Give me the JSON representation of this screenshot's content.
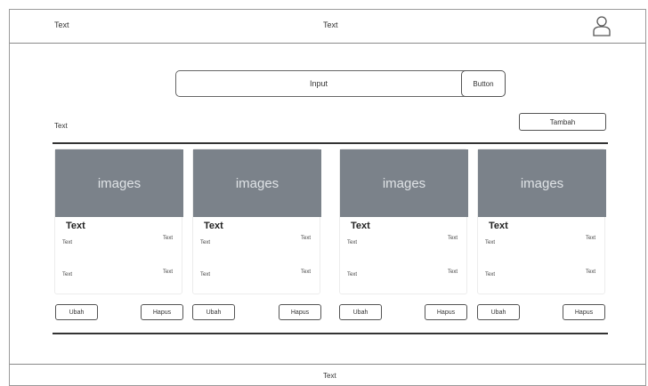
{
  "header": {
    "left_text": "Text",
    "center_text": "Text",
    "user_icon": "user-icon"
  },
  "search": {
    "input_text": "Input",
    "button_label": "Button"
  },
  "section": {
    "label": "Text",
    "add_button": "Tambah"
  },
  "cards": [
    {
      "image_label": "images",
      "title": "Text",
      "text_1": "Text",
      "text_2": "Text",
      "text_3": "Text",
      "text_4": "Text",
      "edit_label": "Ubah",
      "delete_label": "Hapus"
    },
    {
      "image_label": "images",
      "title": "Text",
      "text_1": "Text",
      "text_2": "Text",
      "text_3": "Text",
      "text_4": "Text",
      "edit_label": "Ubah",
      "delete_label": "Hapus"
    },
    {
      "image_label": "images",
      "title": "Text",
      "text_1": "Text",
      "text_2": "Text",
      "text_3": "Text",
      "text_4": "Text",
      "edit_label": "Ubah",
      "delete_label": "Hapus"
    },
    {
      "image_label": "images",
      "title": "Text",
      "text_1": "Text",
      "text_2": "Text",
      "text_3": "Text",
      "text_4": "Text",
      "edit_label": "Ubah",
      "delete_label": "Hapus"
    }
  ],
  "footer": {
    "text": "Text"
  },
  "colors": {
    "image_placeholder": "#7b828a",
    "border": "#555555"
  }
}
